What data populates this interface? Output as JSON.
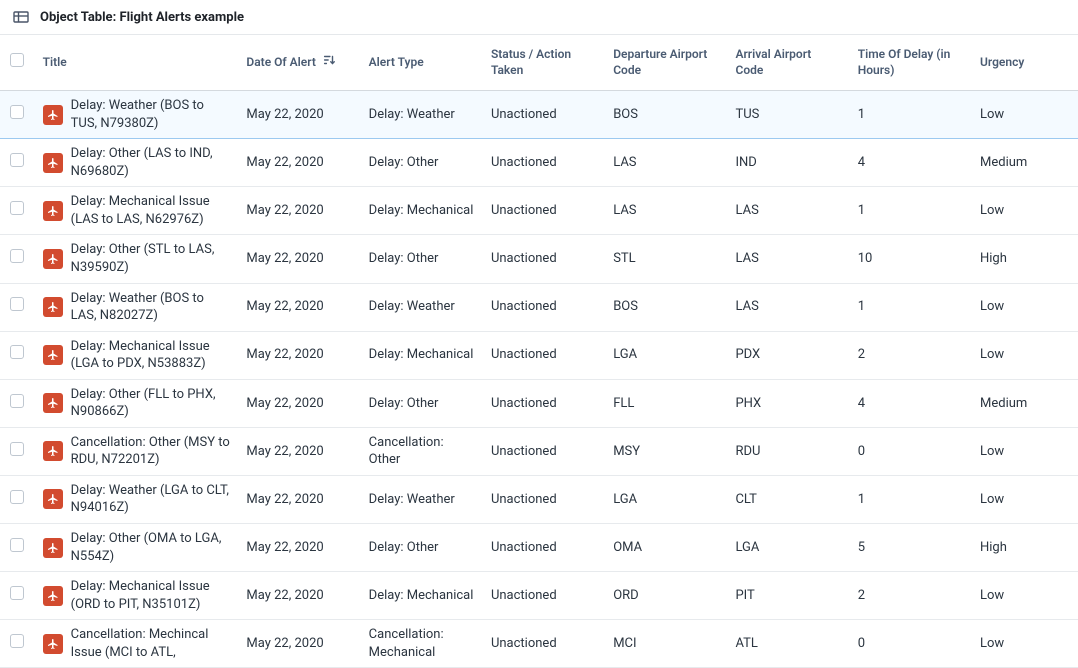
{
  "header": {
    "title": "Object Table: Flight Alerts example"
  },
  "columns": {
    "title": "Title",
    "date": "Date Of Alert",
    "type": "Alert Type",
    "status": "Status / Action Taken",
    "dep": "Departure Airport Code",
    "arr": "Arrival Airport Code",
    "delay": "Time Of Delay (in Hours)",
    "urgency": "Urgency"
  },
  "rows": [
    {
      "title": "Delay: Weather (BOS to TUS, N79380Z)",
      "date": "May 22, 2020",
      "type": "Delay: Weather",
      "status": "Unactioned",
      "dep": "BOS",
      "arr": "TUS",
      "delay": "1",
      "urgency": "Low",
      "selected": true
    },
    {
      "title": "Delay: Other (LAS to IND, N69680Z)",
      "date": "May 22, 2020",
      "type": "Delay: Other",
      "status": "Unactioned",
      "dep": "LAS",
      "arr": "IND",
      "delay": "4",
      "urgency": "Medium"
    },
    {
      "title": "Delay: Mechanical Issue (LAS to LAS, N62976Z)",
      "date": "May 22, 2020",
      "type": "Delay: Mechanical",
      "status": "Unactioned",
      "dep": "LAS",
      "arr": "LAS",
      "delay": "1",
      "urgency": "Low"
    },
    {
      "title": "Delay: Other (STL to LAS, N39590Z)",
      "date": "May 22, 2020",
      "type": "Delay: Other",
      "status": "Unactioned",
      "dep": "STL",
      "arr": "LAS",
      "delay": "10",
      "urgency": "High"
    },
    {
      "title": "Delay: Weather (BOS to LAS, N82027Z)",
      "date": "May 22, 2020",
      "type": "Delay: Weather",
      "status": "Unactioned",
      "dep": "BOS",
      "arr": "LAS",
      "delay": "1",
      "urgency": "Low"
    },
    {
      "title": "Delay: Mechanical Issue (LGA to PDX, N53883Z)",
      "date": "May 22, 2020",
      "type": "Delay: Mechanical",
      "status": "Unactioned",
      "dep": "LGA",
      "arr": "PDX",
      "delay": "2",
      "urgency": "Low"
    },
    {
      "title": "Delay: Other (FLL to PHX, N90866Z)",
      "date": "May 22, 2020",
      "type": "Delay: Other",
      "status": "Unactioned",
      "dep": "FLL",
      "arr": "PHX",
      "delay": "4",
      "urgency": "Medium"
    },
    {
      "title": "Cancellation: Other (MSY to RDU, N72201Z)",
      "date": "May 22, 2020",
      "type": "Cancellation: Other",
      "status": "Unactioned",
      "dep": "MSY",
      "arr": "RDU",
      "delay": "0",
      "urgency": "Low"
    },
    {
      "title": "Delay: Weather (LGA to CLT, N94016Z)",
      "date": "May 22, 2020",
      "type": "Delay: Weather",
      "status": "Unactioned",
      "dep": "LGA",
      "arr": "CLT",
      "delay": "1",
      "urgency": "Low"
    },
    {
      "title": "Delay: Other (OMA to LGA, N554Z)",
      "date": "May 22, 2020",
      "type": "Delay: Other",
      "status": "Unactioned",
      "dep": "OMA",
      "arr": "LGA",
      "delay": "5",
      "urgency": "High"
    },
    {
      "title": "Delay: Mechanical Issue (ORD to PIT, N35101Z)",
      "date": "May 22, 2020",
      "type": "Delay: Mechanical",
      "status": "Unactioned",
      "dep": "ORD",
      "arr": "PIT",
      "delay": "2",
      "urgency": "Low"
    },
    {
      "title": "Cancellation: Mechincal Issue (MCI to ATL,",
      "date": "May 22, 2020",
      "type": "Cancellation: Mechanical",
      "status": "Unactioned",
      "dep": "MCI",
      "arr": "ATL",
      "delay": "0",
      "urgency": "Low"
    }
  ]
}
